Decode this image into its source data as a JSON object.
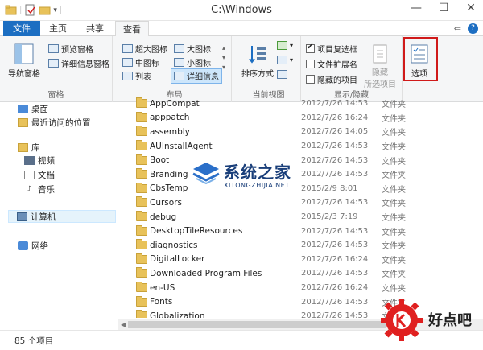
{
  "window": {
    "title": "C:\\Windows",
    "controls": [
      "—",
      "☐",
      "✕"
    ]
  },
  "tabs": [
    {
      "label": "文件"
    },
    {
      "label": "主页"
    },
    {
      "label": "共享"
    },
    {
      "label": "查看"
    }
  ],
  "ribbon": {
    "panes": {
      "label": "窗格",
      "nav_pane": "导航窗格",
      "preview_pane": "预览窗格",
      "details_pane": "详细信息窗格"
    },
    "layout": {
      "label": "布局",
      "options": [
        "超大图标",
        "大图标",
        "中图标",
        "小图标",
        "列表",
        "详细信息"
      ],
      "selected": "详细信息"
    },
    "current_view": {
      "label": "当前视图",
      "sort": "排序方式"
    },
    "show_hide": {
      "label": "显示/隐藏",
      "item_checkboxes": "项目复选框",
      "file_extensions": "文件扩展名",
      "hidden_items": "隐藏的项目",
      "hide_selected": "隐藏",
      "hide_selected_2": "所选项目"
    },
    "options": {
      "label": "选项"
    }
  },
  "nav": {
    "items": [
      {
        "label": "桌面"
      },
      {
        "label": "最近访问的位置"
      },
      {
        "label": "库"
      },
      {
        "label": "视频"
      },
      {
        "label": "文档"
      },
      {
        "label": "音乐"
      },
      {
        "label": "计算机"
      },
      {
        "label": "网络"
      }
    ]
  },
  "files": [
    {
      "name": "AppCompat",
      "date": "2012/7/26 14:53",
      "type": "文件夹"
    },
    {
      "name": "apppatch",
      "date": "2012/7/26 16:24",
      "type": "文件夹"
    },
    {
      "name": "assembly",
      "date": "2012/7/26 14:05",
      "type": "文件夹"
    },
    {
      "name": "AUInstallAgent",
      "date": "2012/7/26 14:53",
      "type": "文件夹"
    },
    {
      "name": "Boot",
      "date": "2012/7/26 14:53",
      "type": "文件夹"
    },
    {
      "name": "Branding",
      "date": "2012/7/26 14:53",
      "type": "文件夹"
    },
    {
      "name": "CbsTemp",
      "date": "2015/2/9 8:01",
      "type": "文件夹"
    },
    {
      "name": "Cursors",
      "date": "2012/7/26 14:53",
      "type": "文件夹"
    },
    {
      "name": "debug",
      "date": "2015/2/3 7:19",
      "type": "文件夹"
    },
    {
      "name": "DesktopTileResources",
      "date": "2012/7/26 14:53",
      "type": "文件夹"
    },
    {
      "name": "diagnostics",
      "date": "2012/7/26 14:53",
      "type": "文件夹"
    },
    {
      "name": "DigitalLocker",
      "date": "2012/7/26 16:24",
      "type": "文件夹"
    },
    {
      "name": "Downloaded Program Files",
      "date": "2012/7/26 14:53",
      "type": "文件夹"
    },
    {
      "name": "en-US",
      "date": "2012/7/26 16:24",
      "type": "文件夹"
    },
    {
      "name": "Fonts",
      "date": "2012/7/26 14:53",
      "type": "文件夹"
    },
    {
      "name": "Globalization",
      "date": "2012/7/26 14:53",
      "type": "文件夹"
    }
  ],
  "status": {
    "count": "85 个项目"
  },
  "watermarks": {
    "site1": "系统之家",
    "site1_url": "XITONGZHIJIA.NET",
    "site2": "好点吧"
  },
  "colors": {
    "file_tab": "#1c6ec2",
    "highlight": "#d01a1a",
    "folder": "#e8c25a"
  }
}
